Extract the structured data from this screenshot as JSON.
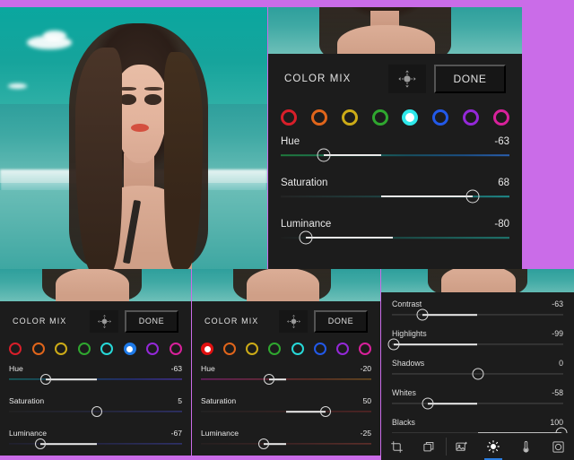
{
  "app": {
    "background_color": "#ca6ce8",
    "panel_color": "#1c1c1c"
  },
  "main_panel": {
    "title": "COLOR MIX",
    "target_icon": "target-adjust-icon",
    "done_label": "DONE",
    "swatches": [
      {
        "name": "red",
        "color": "#d81f2a",
        "selected": false
      },
      {
        "name": "orange",
        "color": "#e0651b",
        "selected": false
      },
      {
        "name": "yellow",
        "color": "#ccab17",
        "selected": false
      },
      {
        "name": "green",
        "color": "#2fa72f",
        "selected": false
      },
      {
        "name": "aqua",
        "color": "#2ee8ea",
        "selected": true
      },
      {
        "name": "blue",
        "color": "#2259e8",
        "selected": false
      },
      {
        "name": "purple",
        "color": "#9428d8",
        "selected": false
      },
      {
        "name": "magenta",
        "color": "#d8219b",
        "selected": false
      }
    ],
    "sliders": [
      {
        "label": "Hue",
        "value": "-63",
        "pos": 19,
        "fill_from": 19,
        "fill_to": 44,
        "gradient": "linear-gradient(90deg,#1f7a3c 0%,#1a6c57 30%,#17505f 55%,#1b4f86 80%,#2a5fb0 100%)"
      },
      {
        "label": "Saturation",
        "value": "68",
        "pos": 84,
        "fill_from": 44,
        "fill_to": 84,
        "gradient": "linear-gradient(90deg,#242424 0%,#1d4a4a 55%,#1e8c8c 100%)"
      },
      {
        "label": "Luminance",
        "value": "-80",
        "pos": 11,
        "fill_from": 11,
        "fill_to": 49,
        "gradient": "linear-gradient(90deg,#1e1e1e 0%,#1b4a46 50%,#1e7a72 100%)"
      }
    ]
  },
  "left_panel": {
    "title": "COLOR MIX",
    "target_icon": "target-adjust-icon",
    "done_label": "DONE",
    "swatches": [
      {
        "name": "red",
        "color": "#d81f2a",
        "selected": false
      },
      {
        "name": "orange",
        "color": "#e0651b",
        "selected": false
      },
      {
        "name": "yellow",
        "color": "#ccab17",
        "selected": false
      },
      {
        "name": "green",
        "color": "#2fa72f",
        "selected": false
      },
      {
        "name": "aqua",
        "color": "#27d8d8",
        "selected": false
      },
      {
        "name": "blue",
        "color": "#1e7ae8",
        "selected": true
      },
      {
        "name": "purple",
        "color": "#9428d8",
        "selected": false
      },
      {
        "name": "magenta",
        "color": "#d8219b",
        "selected": false
      }
    ],
    "sliders": [
      {
        "label": "Hue",
        "value": "-63",
        "pos": 21,
        "fill_from": 21,
        "fill_to": 51,
        "gradient": "linear-gradient(90deg,#138a8a 0%,#15608e 35%,#2a3bb0 70%,#5a3bd0 100%)"
      },
      {
        "label": "Saturation",
        "value": "5",
        "pos": 51,
        "fill_from": 51,
        "fill_to": 51,
        "gradient": "linear-gradient(90deg,#262626 0%,#2b2e55 55%,#3b3f9e 100%)"
      },
      {
        "label": "Luminance",
        "value": "-67",
        "pos": 18,
        "fill_from": 18,
        "fill_to": 51,
        "gradient": "linear-gradient(90deg,#232338 0%,#2b2e66 55%,#3b3f9e 100%)"
      }
    ]
  },
  "mid_panel": {
    "title": "COLOR MIX",
    "target_icon": "target-adjust-icon",
    "done_label": "DONE",
    "swatches": [
      {
        "name": "red",
        "color": "#e01010",
        "selected": true
      },
      {
        "name": "orange",
        "color": "#e0651b",
        "selected": false
      },
      {
        "name": "yellow",
        "color": "#ccab17",
        "selected": false
      },
      {
        "name": "green",
        "color": "#2fa72f",
        "selected": false
      },
      {
        "name": "aqua",
        "color": "#27d8d8",
        "selected": false
      },
      {
        "name": "blue",
        "color": "#2259e8",
        "selected": false
      },
      {
        "name": "purple",
        "color": "#9428d8",
        "selected": false
      },
      {
        "name": "magenta",
        "color": "#d8219b",
        "selected": false
      }
    ],
    "sliders": [
      {
        "label": "Hue",
        "value": "-20",
        "pos": 40,
        "fill_from": 40,
        "fill_to": 50,
        "gradient": "linear-gradient(90deg,#9e2090 0%,#a0305e 30%,#8c3a2c 62%,#9b6a22 100%)"
      },
      {
        "label": "Saturation",
        "value": "50",
        "pos": 73,
        "fill_from": 50,
        "fill_to": 73,
        "gradient": "linear-gradient(90deg,#282828 0%,#4a2626 55%,#7a2a2a 100%)"
      },
      {
        "label": "Luminance",
        "value": "-25",
        "pos": 37,
        "fill_from": 37,
        "fill_to": 50,
        "gradient": "linear-gradient(90deg,#2b2222 0%,#5a2a2a 55%,#8a3a32 100%)"
      }
    ]
  },
  "tone_panel": {
    "sliders": [
      {
        "label": "Contrast",
        "value": "-63",
        "pos": 18,
        "fill_from": 18,
        "fill_to": 50
      },
      {
        "label": "Highlights",
        "value": "-99",
        "pos": 1,
        "fill_from": 1,
        "fill_to": 50
      },
      {
        "label": "Shadows",
        "value": "0",
        "pos": 50,
        "fill_from": 50,
        "fill_to": 50
      },
      {
        "label": "Whites",
        "value": "-58",
        "pos": 21,
        "fill_from": 21,
        "fill_to": 50
      },
      {
        "label": "Blacks",
        "value": "100",
        "pos": 99,
        "fill_from": 50,
        "fill_to": 99
      }
    ]
  },
  "toolbar": {
    "active_index": 3,
    "items": [
      {
        "name": "crop-icon",
        "label": "Crop"
      },
      {
        "name": "layers-icon",
        "label": "Layers"
      },
      {
        "name": "presets-image-icon",
        "label": "Presets"
      },
      {
        "name": "light-sun-icon",
        "label": "Light"
      },
      {
        "name": "color-thermometer-icon",
        "label": "Color"
      },
      {
        "name": "effects-frame-icon",
        "label": "Effects"
      }
    ]
  }
}
